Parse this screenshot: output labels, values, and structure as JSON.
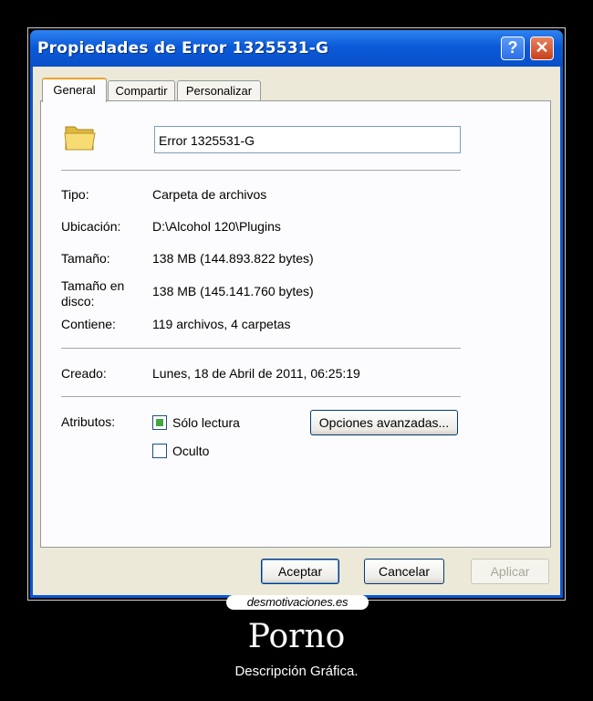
{
  "window": {
    "title": "Propiedades de Error 1325531-G",
    "help_label": "?",
    "close_label": "✕"
  },
  "tabs": [
    {
      "label": "General",
      "active": true
    },
    {
      "label": "Compartir",
      "active": false
    },
    {
      "label": "Personalizar",
      "active": false
    }
  ],
  "general": {
    "icon": "folder-icon",
    "name_value": "Error 1325531-G",
    "tipo_label": "Tipo:",
    "tipo_value": "Carpeta de archivos",
    "ubicacion_label": "Ubicación:",
    "ubicacion_value": "D:\\Alcohol 120\\Plugins",
    "tamano_label": "Tamaño:",
    "tamano_value": "138 MB (144.893.822 bytes)",
    "tamano_disco_label": "Tamaño en disco:",
    "tamano_disco_value": "138 MB (145.141.760 bytes)",
    "contiene_label": "Contiene:",
    "contiene_value": "119 archivos, 4 carpetas",
    "creado_label": "Creado:",
    "creado_value": "Lunes, 18 de Abril de 2011, 06:25:19",
    "atributos_label": "Atributos:",
    "solo_lectura_label": "Sólo lectura",
    "solo_lectura_checked": true,
    "oculto_label": "Oculto",
    "oculto_checked": false,
    "opciones_button": "Opciones avanzadas..."
  },
  "footer": {
    "aceptar": "Aceptar",
    "cancelar": "Cancelar",
    "aplicar": "Aplicar"
  },
  "poster": {
    "logo_text": "desmotivaciones.es",
    "title": "Porno",
    "subtitle": "Descripción Gráfica."
  },
  "colors": {
    "titlebar": "#0b5ad9",
    "dialog_bg": "#ece9d8",
    "tab_accent": "#f3a32a",
    "checkbox_fill": "#3ea83e"
  }
}
